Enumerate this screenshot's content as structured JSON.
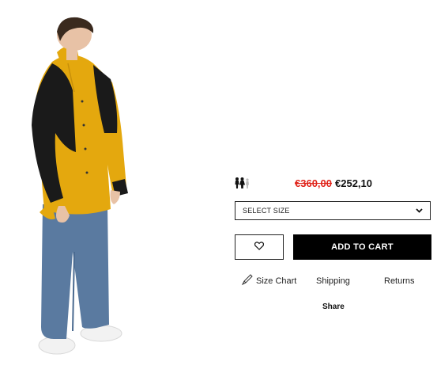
{
  "product": {
    "image_alt": "Model wearing yellow and black mountain jacket with blue jeans",
    "gender_icon": "unisex-icon",
    "old_price": "€360,00",
    "new_price": "€252,10"
  },
  "size_select": {
    "label": "SELECT SIZE",
    "icon": "chevron-down-icon"
  },
  "actions": {
    "wishlist_icon": "heart-icon",
    "add_to_cart": "ADD TO CART"
  },
  "links": {
    "size_chart_icon": "ruler-pencil-icon",
    "size_chart": "Size Chart",
    "shipping": "Shipping",
    "returns": "Returns"
  },
  "share": "Share",
  "colors": {
    "jacket_yellow": "#e4a80e",
    "jacket_black": "#1a1a1a",
    "jeans_blue": "#5a7aa0",
    "sale_red": "#e0231a",
    "button_black": "#000000"
  }
}
